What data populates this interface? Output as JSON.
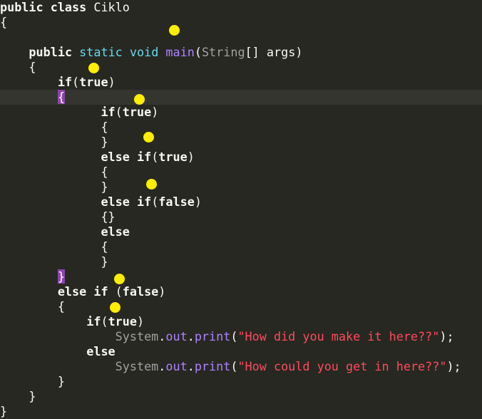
{
  "editor": {
    "lines": [
      {
        "segments": [
          {
            "t": "public class ",
            "c": "kw"
          },
          {
            "t": "Ciklo",
            "c": "plain"
          }
        ]
      },
      {
        "segments": [
          {
            "t": "{",
            "c": "punct"
          }
        ]
      },
      {
        "segments": []
      },
      {
        "segments": [
          {
            "t": "    ",
            "c": "plain"
          },
          {
            "t": "public ",
            "c": "kw"
          },
          {
            "t": "static ",
            "c": "storage"
          },
          {
            "t": "void ",
            "c": "storage"
          },
          {
            "t": "main",
            "c": "func"
          },
          {
            "t": "(",
            "c": "punct"
          },
          {
            "t": "String",
            "c": "type"
          },
          {
            "t": "[] ",
            "c": "punct"
          },
          {
            "t": "args",
            "c": "plain"
          },
          {
            "t": ")",
            "c": "punct"
          }
        ]
      },
      {
        "segments": [
          {
            "t": "    {",
            "c": "punct"
          }
        ]
      },
      {
        "segments": [
          {
            "t": "        ",
            "c": "plain"
          },
          {
            "t": "if",
            "c": "kw"
          },
          {
            "t": "(",
            "c": "punct"
          },
          {
            "t": "true",
            "c": "kw"
          },
          {
            "t": ")",
            "c": "punct"
          }
        ]
      },
      {
        "current": true,
        "segments": [
          {
            "t": "        ",
            "c": "plain"
          },
          {
            "t": "{",
            "c": "match"
          }
        ]
      },
      {
        "segments": [
          {
            "t": "              ",
            "c": "plain"
          },
          {
            "t": "if",
            "c": "kw"
          },
          {
            "t": "(",
            "c": "punct"
          },
          {
            "t": "true",
            "c": "kw"
          },
          {
            "t": ")",
            "c": "punct"
          }
        ]
      },
      {
        "segments": [
          {
            "t": "              {",
            "c": "punct"
          }
        ]
      },
      {
        "segments": [
          {
            "t": "              }",
            "c": "punct"
          }
        ]
      },
      {
        "segments": [
          {
            "t": "              ",
            "c": "plain"
          },
          {
            "t": "else if",
            "c": "kw"
          },
          {
            "t": "(",
            "c": "punct"
          },
          {
            "t": "true",
            "c": "kw"
          },
          {
            "t": ")",
            "c": "punct"
          }
        ]
      },
      {
        "segments": [
          {
            "t": "              {",
            "c": "punct"
          }
        ]
      },
      {
        "segments": [
          {
            "t": "              }",
            "c": "punct"
          }
        ]
      },
      {
        "segments": [
          {
            "t": "              ",
            "c": "plain"
          },
          {
            "t": "else if",
            "c": "kw"
          },
          {
            "t": "(",
            "c": "punct"
          },
          {
            "t": "false",
            "c": "kw"
          },
          {
            "t": ")",
            "c": "punct"
          }
        ]
      },
      {
        "segments": [
          {
            "t": "              {}",
            "c": "punct"
          }
        ]
      },
      {
        "segments": [
          {
            "t": "              ",
            "c": "plain"
          },
          {
            "t": "else",
            "c": "kw"
          }
        ]
      },
      {
        "segments": [
          {
            "t": "              {",
            "c": "punct"
          }
        ]
      },
      {
        "segments": [
          {
            "t": "              }",
            "c": "punct"
          }
        ]
      },
      {
        "segments": [
          {
            "t": "        ",
            "c": "plain"
          },
          {
            "t": "}",
            "c": "match"
          }
        ]
      },
      {
        "segments": [
          {
            "t": "        ",
            "c": "plain"
          },
          {
            "t": "else if ",
            "c": "kw"
          },
          {
            "t": "(",
            "c": "punct"
          },
          {
            "t": "false",
            "c": "kw"
          },
          {
            "t": ")",
            "c": "punct"
          }
        ]
      },
      {
        "segments": [
          {
            "t": "        {",
            "c": "punct"
          }
        ]
      },
      {
        "segments": [
          {
            "t": "            ",
            "c": "plain"
          },
          {
            "t": "if",
            "c": "kw"
          },
          {
            "t": "(",
            "c": "punct"
          },
          {
            "t": "true",
            "c": "kw"
          },
          {
            "t": ")",
            "c": "punct"
          }
        ]
      },
      {
        "segments": [
          {
            "t": "                ",
            "c": "plain"
          },
          {
            "t": "System",
            "c": "cls"
          },
          {
            "t": ".",
            "c": "dot"
          },
          {
            "t": "out",
            "c": "field"
          },
          {
            "t": ".",
            "c": "dot"
          },
          {
            "t": "print",
            "c": "field"
          },
          {
            "t": "(",
            "c": "punct"
          },
          {
            "t": "\"How did you make it here??\"",
            "c": "str"
          },
          {
            "t": ");",
            "c": "punct"
          }
        ]
      },
      {
        "segments": [
          {
            "t": "            ",
            "c": "plain"
          },
          {
            "t": "else",
            "c": "kw"
          }
        ]
      },
      {
        "segments": [
          {
            "t": "                ",
            "c": "plain"
          },
          {
            "t": "System",
            "c": "cls"
          },
          {
            "t": ".",
            "c": "dot"
          },
          {
            "t": "out",
            "c": "field"
          },
          {
            "t": ".",
            "c": "dot"
          },
          {
            "t": "print",
            "c": "field"
          },
          {
            "t": "(",
            "c": "punct"
          },
          {
            "t": "\"How could you get in here??\"",
            "c": "str"
          },
          {
            "t": ");",
            "c": "punct"
          }
        ]
      },
      {
        "segments": [
          {
            "t": "        }",
            "c": "punct"
          }
        ]
      },
      {
        "segments": [
          {
            "t": "    }",
            "c": "punct"
          }
        ]
      },
      {
        "segments": [
          {
            "t": "}",
            "c": "punct"
          }
        ]
      }
    ]
  },
  "colors": {
    "background": "#272822",
    "current_line": "#34352f",
    "bracket_match": "#8e44ad",
    "marker": "#ffee00",
    "string": "#ff4b5c",
    "method": "#ae81ff",
    "storage": "#66d9ef"
  }
}
